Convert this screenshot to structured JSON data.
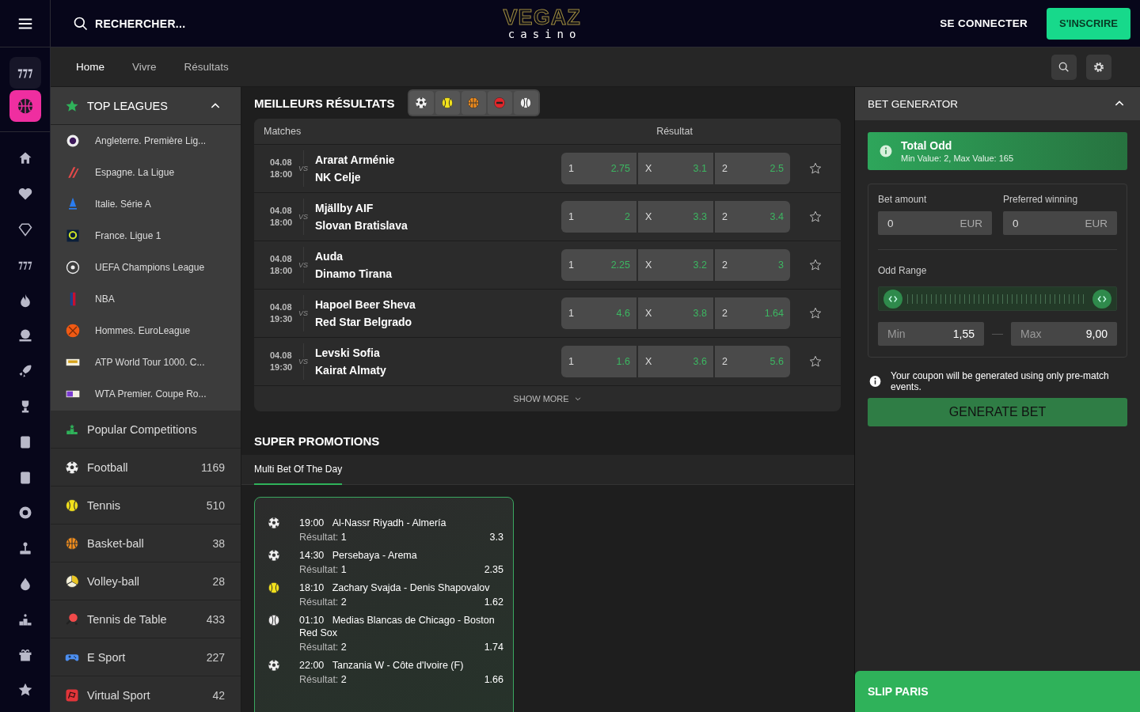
{
  "header": {
    "search_placeholder": "RECHERCHER...",
    "logo": {
      "brand": "VEGAZ",
      "tagline": "casino"
    },
    "login": "SE CONNECTER",
    "signup": "S'INSCRIRE"
  },
  "rail": {
    "pinned": [
      {
        "selected": false
      },
      {
        "selected": true
      }
    ]
  },
  "nav": {
    "tabs": [
      {
        "label": "Home",
        "selected": true
      },
      {
        "label": "Vivre",
        "selected": false
      },
      {
        "label": "Résultats",
        "selected": false
      }
    ]
  },
  "sidebar": {
    "top_leagues": {
      "title": "TOP LEAGUES",
      "expanded": true,
      "items": [
        {
          "name": "Angleterre. Première Lig..."
        },
        {
          "name": "Espagne. La Ligue"
        },
        {
          "name": "Italie. Série A"
        },
        {
          "name": "France. Ligue 1"
        },
        {
          "name": "UEFA Champions League"
        },
        {
          "name": "NBA"
        },
        {
          "name": "Hommes. EuroLeague"
        },
        {
          "name": "ATP World Tour 1000. C..."
        },
        {
          "name": "WTA Premier. Coupe Ro..."
        }
      ]
    },
    "sports": [
      {
        "kind": "podium",
        "name": "Popular Competitions"
      },
      {
        "kind": "football",
        "name": "Football",
        "count": "1169"
      },
      {
        "kind": "tennis",
        "name": "Tennis",
        "count": "510"
      },
      {
        "kind": "basketball",
        "name": "Basket-ball",
        "count": "38"
      },
      {
        "kind": "volleyball",
        "name": "Volley-ball",
        "count": "28"
      },
      {
        "kind": "pingpong",
        "name": "Tennis de Table",
        "count": "433"
      },
      {
        "kind": "esport",
        "name": "E Sport",
        "count": "227"
      },
      {
        "kind": "virtual",
        "name": "Virtual Sport",
        "count": "42"
      }
    ]
  },
  "results": {
    "title": "MEILLEURS RÉSULTATS",
    "filters": [
      {
        "kind": "football"
      },
      {
        "kind": "tennis"
      },
      {
        "kind": "basketball"
      },
      {
        "kind": "mma"
      },
      {
        "kind": "baseball"
      }
    ],
    "columns": [
      "Matches",
      "Résultat"
    ],
    "matches": [
      {
        "date": "04.08",
        "time": "18:00",
        "vs": "VS",
        "home": "Ararat Arménie",
        "away": "NK Celje",
        "odds": [
          {
            "label": "1",
            "value": "2.75"
          },
          {
            "label": "X",
            "value": "3.1"
          },
          {
            "label": "2",
            "value": "2.5"
          }
        ],
        "favorite": false
      },
      {
        "date": "04.08",
        "time": "18:00",
        "vs": "VS",
        "home": "Mjällby AIF",
        "away": "Slovan Bratislava",
        "odds": [
          {
            "label": "1",
            "value": "2"
          },
          {
            "label": "X",
            "value": "3.3"
          },
          {
            "label": "2",
            "value": "3.4"
          }
        ],
        "favorite": false
      },
      {
        "date": "04.08",
        "time": "18:00",
        "vs": "VS",
        "home": "Auda",
        "away": "Dinamo Tirana",
        "odds": [
          {
            "label": "1",
            "value": "2.25"
          },
          {
            "label": "X",
            "value": "3.2"
          },
          {
            "label": "2",
            "value": "3"
          }
        ],
        "favorite": false
      },
      {
        "date": "04.08",
        "time": "19:30",
        "vs": "VS",
        "home": "Hapoel Beer Sheva",
        "away": "Red Star Belgrado",
        "odds": [
          {
            "label": "1",
            "value": "4.6"
          },
          {
            "label": "X",
            "value": "3.8"
          },
          {
            "label": "2",
            "value": "1.64"
          }
        ],
        "favorite": false
      },
      {
        "date": "04.08",
        "time": "19:30",
        "vs": "VS",
        "home": "Levski Sofia",
        "away": "Kairat Almaty",
        "odds": [
          {
            "label": "1",
            "value": "1.6"
          },
          {
            "label": "X",
            "value": "3.6"
          },
          {
            "label": "2",
            "value": "5.6"
          }
        ],
        "favorite": false
      }
    ],
    "show_more": "SHOW MORE"
  },
  "promotions": {
    "title": "SUPER PROMOTIONS",
    "tabs": [
      {
        "label": "Multi Bet Of The Day",
        "selected": true
      }
    ],
    "bets": [
      {
        "kind": "football",
        "time": "19:00",
        "match": "Al-Nassr Riyadh - Almería",
        "result_label": "Résultat:",
        "result": "1",
        "odd": "3.3"
      },
      {
        "kind": "football",
        "time": "14:30",
        "match": "Persebaya - Arema",
        "result_label": "Résultat:",
        "result": "1",
        "odd": "2.35"
      },
      {
        "kind": "tennis",
        "time": "18:10",
        "match": "Zachary Svajda - Denis Shapovalov",
        "result_label": "Résultat:",
        "result": "2",
        "odd": "1.62"
      },
      {
        "kind": "baseball",
        "time": "01:10",
        "match": "Medias Blancas de Chicago - Boston Red Sox",
        "result_label": "Résultat:",
        "result": "2",
        "odd": "1.74"
      },
      {
        "kind": "football",
        "time": "22:00",
        "match": "Tanzania W - Côte d'Ivoire (F)",
        "result_label": "Résultat:",
        "result": "2",
        "odd": "1.66"
      }
    ]
  },
  "bet_generator": {
    "title": "BET GENERATOR",
    "expanded": true,
    "total_odd": {
      "title": "Total Odd",
      "subtitle": "Min Value: 2, Max Value: 165"
    },
    "bet_amount": {
      "label": "Bet amount",
      "value": "0",
      "currency": "EUR"
    },
    "preferred_winning": {
      "label": "Preferred winning",
      "value": "0",
      "currency": "EUR"
    },
    "odd_range": {
      "label": "Odd Range",
      "level": 1,
      "min": {
        "placeholder": "Min",
        "value": "1,55"
      },
      "max": {
        "placeholder": "Max",
        "value": "9,00"
      }
    },
    "note": "Your coupon will be generated using only pre-match events.",
    "generate": "GENERATE BET"
  },
  "bet_slip": {
    "title": "SLIP PARIS"
  }
}
